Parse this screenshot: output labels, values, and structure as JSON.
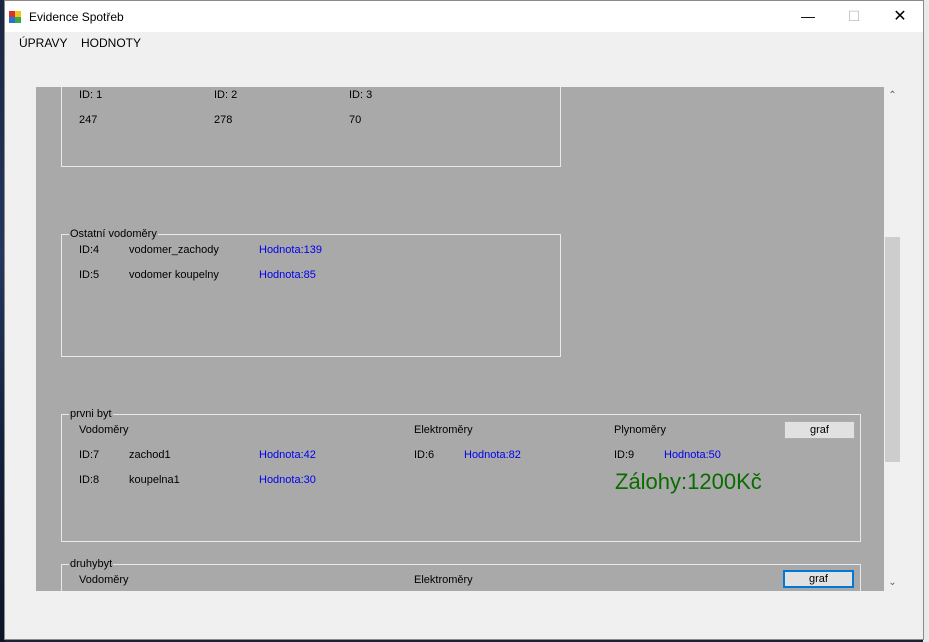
{
  "window": {
    "title": "Evidence Spotřeb"
  },
  "menu": [
    {
      "label": "ÚPRAVY"
    },
    {
      "label": "HODNOTY"
    }
  ],
  "top_group": {
    "ids": [
      "ID: 1",
      "ID: 2",
      "ID: 3"
    ],
    "values": [
      "247",
      "278",
      "70"
    ]
  },
  "ostatni_group": {
    "title": "Ostatní vodoměry",
    "rows": [
      {
        "id": "ID:4",
        "name": "vodomer_zachody",
        "value": "Hodnota:139"
      },
      {
        "id": "ID:5",
        "name": "vodomer koupelny",
        "value": "Hodnota:85"
      }
    ]
  },
  "prvni_byt": {
    "title": "prvni byt",
    "vodomery_label": "Vodoměry",
    "elektromery_label": "Elektroměry",
    "plynomery_label": "Plynoměry",
    "graf_label": "graf",
    "vodomery": [
      {
        "id": "ID:7",
        "name": "zachod1",
        "value": "Hodnota:42"
      },
      {
        "id": "ID:8",
        "name": "koupelna1",
        "value": "Hodnota:30"
      }
    ],
    "elektromer": {
      "id": "ID:6",
      "value": "Hodnota:82"
    },
    "plynomer": {
      "id": "ID:9",
      "value": "Hodnota:50"
    },
    "zalohy": "Zálohy:1200Kč",
    "zalohy_color": "#0a6b00"
  },
  "druhy_byt": {
    "title": "druhybyt",
    "vodomery_label": "Vodoměry",
    "elektromery_label": "Elektroměry",
    "graf_label": "graf"
  },
  "colors": {
    "panel": "#a9a9a9",
    "link": "#0000ee",
    "focus": "#0078d7"
  }
}
